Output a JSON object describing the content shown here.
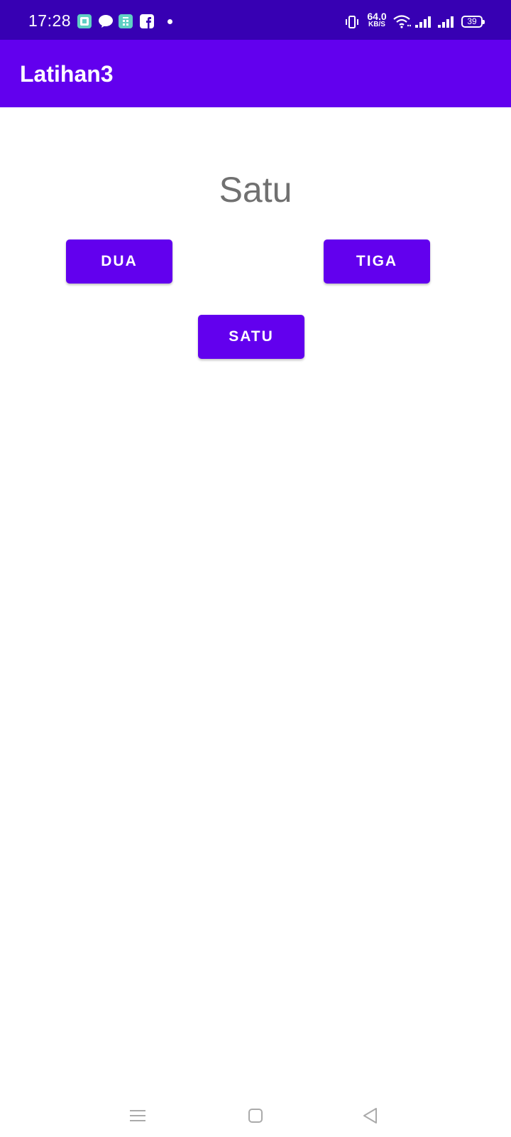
{
  "status_bar": {
    "time": "17:28",
    "notifications": [
      "app-square-icon",
      "kakaotalk-icon",
      "calculator-app-icon",
      "facebook-icon",
      "dot-icon"
    ],
    "speed_value": "64.0",
    "speed_unit": "KB/S",
    "battery_level": "39",
    "indicators": [
      "vibrate-icon",
      "wifi-icon",
      "signal-icon",
      "signal-icon"
    ]
  },
  "app_bar": {
    "title": "Latihan3"
  },
  "main": {
    "display_text": "Satu",
    "buttons": {
      "dua": "DUA",
      "tiga": "TIGA",
      "satu": "SATU"
    }
  },
  "nav_bar": {
    "buttons": [
      "menu-icon",
      "home-icon",
      "back-icon"
    ]
  },
  "colors": {
    "status_bar": "#3700B3",
    "app_bar": "#6200EE",
    "button": "#6200EE",
    "display_text": "#707070"
  }
}
